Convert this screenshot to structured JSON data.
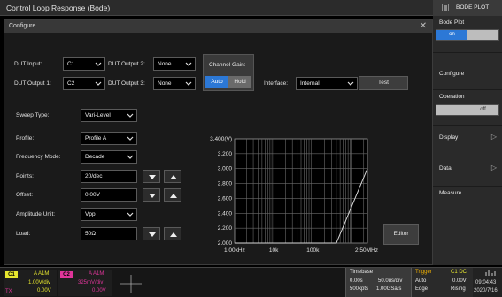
{
  "window": {
    "title": "Control Loop Response (Bode)",
    "right_label": "BODE PLOT"
  },
  "panel": {
    "header": "Configure"
  },
  "top": {
    "dut_input_label": "DUT Input:",
    "dut_input_value": "C1",
    "dut_output1_label": "DUT Output 1:",
    "dut_output1_value": "C2",
    "dut_output2_label": "DUT Output 2:",
    "dut_output2_value": "None",
    "dut_output3_label": "DUT Output 3:",
    "dut_output3_value": "None",
    "channel_gain_label": "Channel Gain:",
    "gain_auto": "Auto",
    "gain_hold": "Hold",
    "interface_label": "Interface:",
    "interface_value": "Internal",
    "test_button": "Test"
  },
  "form": {
    "sweep_type_label": "Sweep Type:",
    "sweep_type_value": "Vari-Level",
    "profile_label": "Profile:",
    "profile_value": "Profile A",
    "freq_mode_label": "Frequency Mode:",
    "freq_mode_value": "Decade",
    "points_label": "Points:",
    "points_value": "20/dec",
    "offset_label": "Offset:",
    "offset_value": "0.00V",
    "amp_unit_label": "Amplitude Unit:",
    "amp_unit_value": "Vpp",
    "load_label": "Load:",
    "load_value": "50Ω"
  },
  "editor_button": "Editor",
  "chart_data": {
    "type": "line",
    "y_top_label": "3.400(V)",
    "y_ticks": [
      "3.200",
      "3.000",
      "2.800",
      "2.600",
      "2.400",
      "2.200",
      "2.000"
    ],
    "x_ticks": [
      "1.00kHz",
      "10k",
      "100k",
      "2.50MHz"
    ],
    "ylim": [
      2.0,
      3.4
    ],
    "x_scale": "log",
    "xlim_hz": [
      1000,
      2500000
    ],
    "grid": true,
    "series": [
      {
        "x_hz": [
          1000,
          400000,
          2500000
        ],
        "y": [
          2.0,
          2.0,
          3.0
        ]
      }
    ]
  },
  "side": {
    "bode_plot_label": "Bode Plot",
    "bode_on": "on",
    "configure": "Configure",
    "operation": "Operation",
    "operation_off": "off",
    "display": "Display",
    "data": "Data",
    "measure": "Measure"
  },
  "status": {
    "c1": {
      "tag": "C1",
      "coupling": "A A1M",
      "scale": "1.00V/div",
      "offset": "0.00V"
    },
    "c2": {
      "tag": "C2",
      "coupling": "A A1M",
      "scale": "325mV/div",
      "offset": "0.00V"
    },
    "tx": "TX",
    "timebase": {
      "label": "Timebase",
      "delay": "0.00s",
      "tdiv": "50.0us/div",
      "pts": "500kpts",
      "rate": "1.00GSa/s"
    },
    "trigger": {
      "label": "Trigger",
      "src": "C1 DC",
      "mode": "Auto",
      "level": "0.00V",
      "type": "Edge",
      "slope": "Rising"
    },
    "time": "09:04:43",
    "date": "2020/7/16"
  },
  "colors": {
    "c1": "#e6e62e",
    "c2": "#e0359a",
    "accent_blue": "#2c78d6",
    "trigger": "#f0b000"
  }
}
